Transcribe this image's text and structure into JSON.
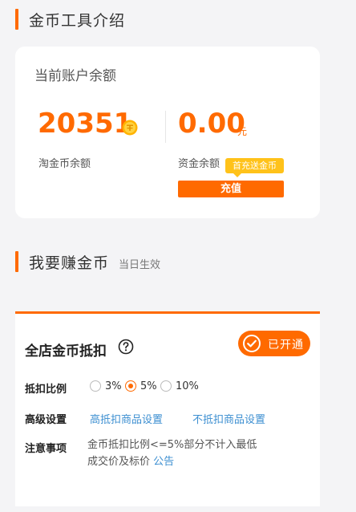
{
  "intro_section": {
    "title": "金币工具介绍"
  },
  "account": {
    "title": "当前账户余额",
    "coins_value": "20351",
    "coins_label": "淘金币余额",
    "funds_value": "0.00",
    "funds_unit": "元",
    "funds_label": "资金余额",
    "promo_badge": "首充送金币",
    "recharge_label": "充值"
  },
  "earn_section": {
    "title": "我要赚金币",
    "subtitle": "当日生效"
  },
  "deduction": {
    "title": "全店金币抵扣",
    "status_label": "已开通",
    "ratio_label": "抵扣比例",
    "ratio_options": [
      {
        "label": "3%",
        "selected": false
      },
      {
        "label": "5%",
        "selected": true
      },
      {
        "label": "10%",
        "selected": false
      }
    ],
    "advanced_label": "高级设置",
    "link_high": "高抵扣商品设置",
    "link_no": "不抵扣商品设置",
    "notes_label": "注意事项",
    "notes_line1": "金币抵扣比例<=5%部分不计入最低",
    "notes_line2": "成交价及标价",
    "notes_link": "公告"
  },
  "colors": {
    "accent": "#ff6a00",
    "badge": "#ffc21a",
    "link": "#3d8fd1"
  }
}
